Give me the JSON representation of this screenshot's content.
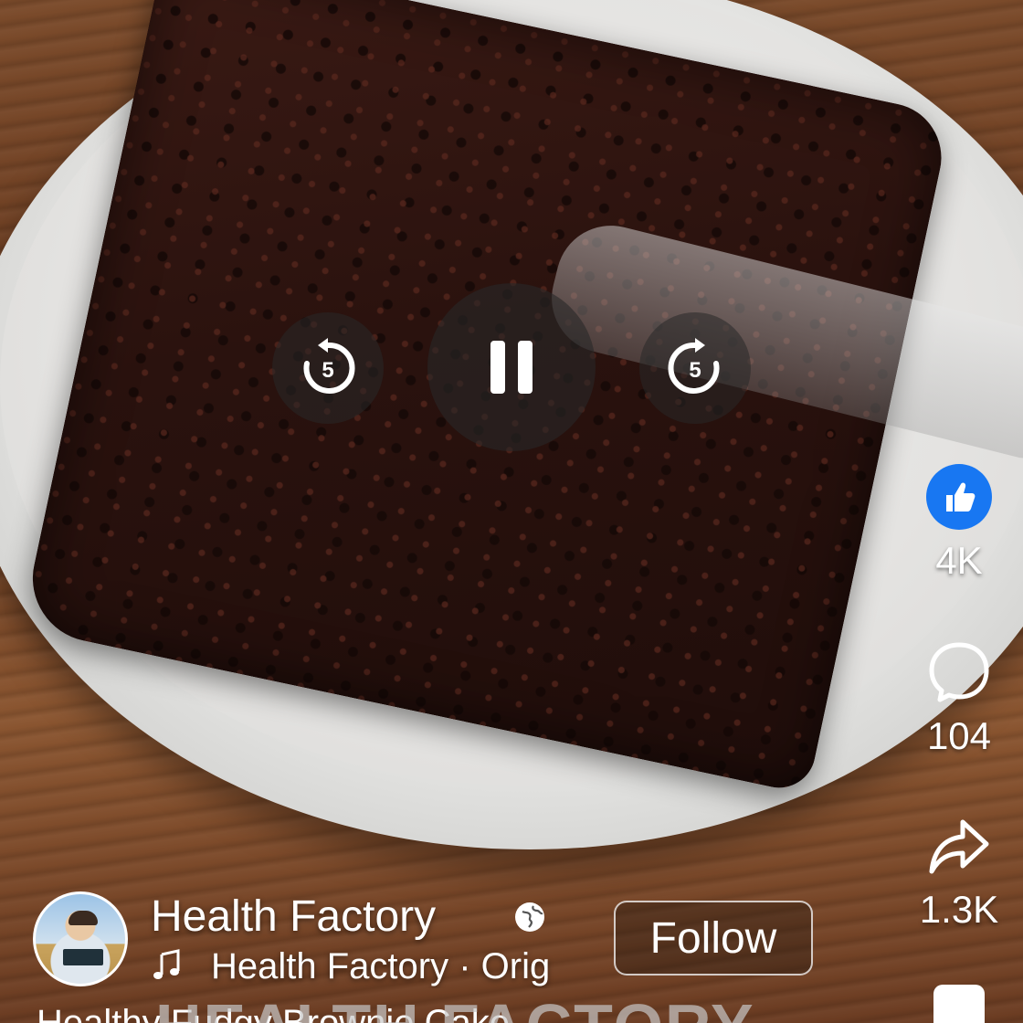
{
  "player": {
    "rewind_seconds": "5",
    "forward_seconds": "5",
    "state": "playing"
  },
  "rail": {
    "likes": "4K",
    "comments": "104",
    "shares": "1.3K"
  },
  "post": {
    "channel_name": "Health Factory",
    "audio": "Health Factory · Orig",
    "follow_label": "Follow",
    "watermark": "HEALTH FACTORY",
    "caption_peek": "Healthy Fudgy Brownie Cake"
  },
  "icons": {
    "like": "thumbs-up-icon",
    "comment": "speech-bubble-icon",
    "share": "share-arrow-icon",
    "globe": "globe-icon",
    "music": "music-note-icon"
  },
  "colors": {
    "like_blue": "#1877f2",
    "text": "#ffffff"
  }
}
